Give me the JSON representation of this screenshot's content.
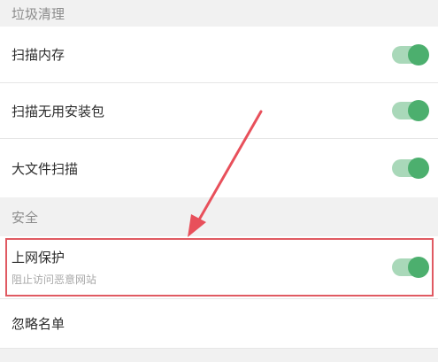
{
  "sections": {
    "junk_cleanup": {
      "title": "垃圾清理"
    },
    "security": {
      "title": "安全"
    }
  },
  "rows": {
    "scan_memory": {
      "label": "扫描内存",
      "enabled": true
    },
    "scan_unused_apk": {
      "label": "扫描无用安装包",
      "enabled": true
    },
    "scan_large_files": {
      "label": "大文件扫描",
      "enabled": true
    },
    "web_protection": {
      "label": "上网保护",
      "subtitle": "阻止访问恶意网站",
      "enabled": true
    },
    "ignore_list": {
      "label": "忽略名单"
    }
  },
  "colors": {
    "toggle_track": "#a9d8b9",
    "toggle_knob": "#4caf6e",
    "highlight": "#e05a62",
    "arrow": "#e8505b"
  }
}
